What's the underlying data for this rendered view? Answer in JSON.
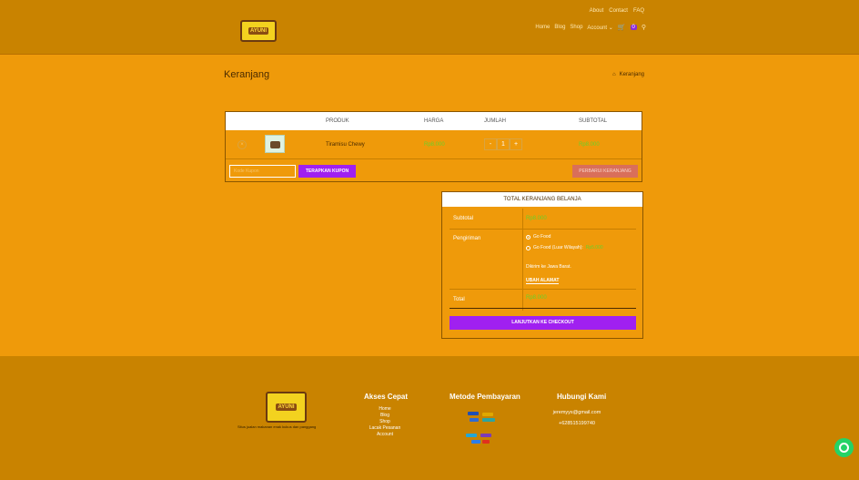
{
  "header": {
    "logo_text": "AYUNI",
    "top_links": [
      "About",
      "Contact",
      "FAQ"
    ],
    "nav": [
      "Home",
      "Blog",
      "Shop",
      "Account ⌄"
    ],
    "cart_count": "0",
    "cart_icon": "cart-icon",
    "search_icon": "search-icon"
  },
  "page": {
    "title": "Keranjang",
    "breadcrumb": "Keranjang",
    "home_icon": "home-icon"
  },
  "cart": {
    "columns": [
      "PRODUK",
      "HARGA",
      "JUMLAH",
      "SUBTOTAL"
    ],
    "item": {
      "name": "Tiramisu Chewy",
      "price": "Rp8.000",
      "qty_minus": "-",
      "qty": "1",
      "qty_plus": "+",
      "subtotal": "Rp8.000"
    },
    "coupon_placeholder": "Kode Kupon",
    "apply_coupon": "TERAPKAN KUPON",
    "update_cart": "PERBARUI KERANJANG"
  },
  "totals": {
    "title": "TOTAL KERANJANG BELANJA",
    "subtotal_label": "Subtotal",
    "subtotal_value": "Rp8.000",
    "shipping_label": "Pengiriman",
    "shipping_option_1": "Go Food",
    "shipping_option_2": "Go Food (Luar Wilayah):",
    "shipping_option_2_price": "Rp5.000",
    "destination": "Dikirim ke Jawa Barat.",
    "change_address": "UBAH ALAMAT",
    "total_label": "Total",
    "total_value": "Rp8.000",
    "checkout": "LANJUTKAN KE CHECKOUT"
  },
  "footer": {
    "tagline": "Situs jualan makanan enak kukus dan panggang",
    "quick_title": "Akses Cepat",
    "quick_links": [
      "Home",
      "Blog",
      "Shop",
      "Lacak Pesanan",
      "Account"
    ],
    "payment_title": "Metode Pembayaran",
    "contact_title": "Hubungi Kami",
    "email": "jeremyys@gmail.com",
    "phone": "+628515199740",
    "whatsapp_icon": "whatsapp-icon"
  },
  "colors": {
    "background": "#ef9a0a",
    "header": "#c98300",
    "accent": "#a020f0",
    "price": "#6bd12a"
  }
}
